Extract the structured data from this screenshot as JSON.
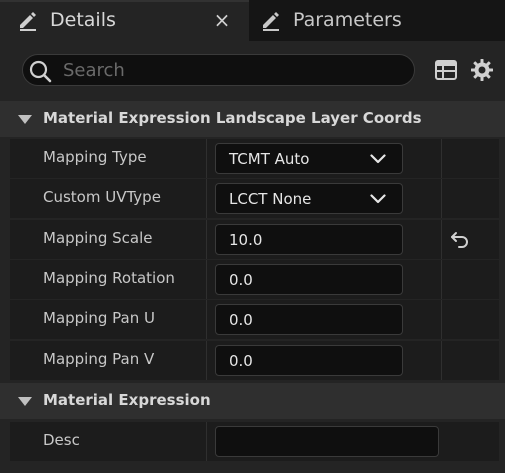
{
  "tabs": [
    {
      "label": "Details",
      "icon": "pencil-icon",
      "active": true,
      "close_label": "×"
    },
    {
      "label": "Parameters",
      "icon": "pencil-icon",
      "active": false
    }
  ],
  "search": {
    "placeholder": "Search",
    "value": ""
  },
  "toolbar": {
    "view_icon": "table-icon",
    "settings_icon": "gear-icon"
  },
  "sections": [
    {
      "title": "Material Expression Landscape Layer Coords",
      "expanded": true,
      "properties": [
        {
          "label": "Mapping Type",
          "type": "combo",
          "value": "TCMT Auto"
        },
        {
          "label": "Custom UVType",
          "type": "combo",
          "value": "LCCT None"
        },
        {
          "label": "Mapping Scale",
          "type": "number",
          "value": "10.0",
          "reset_to_default": true
        },
        {
          "label": "Mapping Rotation",
          "type": "number",
          "value": "0.0"
        },
        {
          "label": "Mapping Pan U",
          "type": "number",
          "value": "0.0"
        },
        {
          "label": "Mapping Pan V",
          "type": "number",
          "value": "0.0"
        }
      ]
    },
    {
      "title": "Material Expression",
      "expanded": true,
      "properties": [
        {
          "label": "Desc",
          "type": "text",
          "value": ""
        }
      ]
    }
  ],
  "colors": {
    "panel": "#242424",
    "row": "#1c1c1c",
    "header": "#2f2f2f",
    "field": "#0f0f0f",
    "text": "#c8c8c8"
  }
}
